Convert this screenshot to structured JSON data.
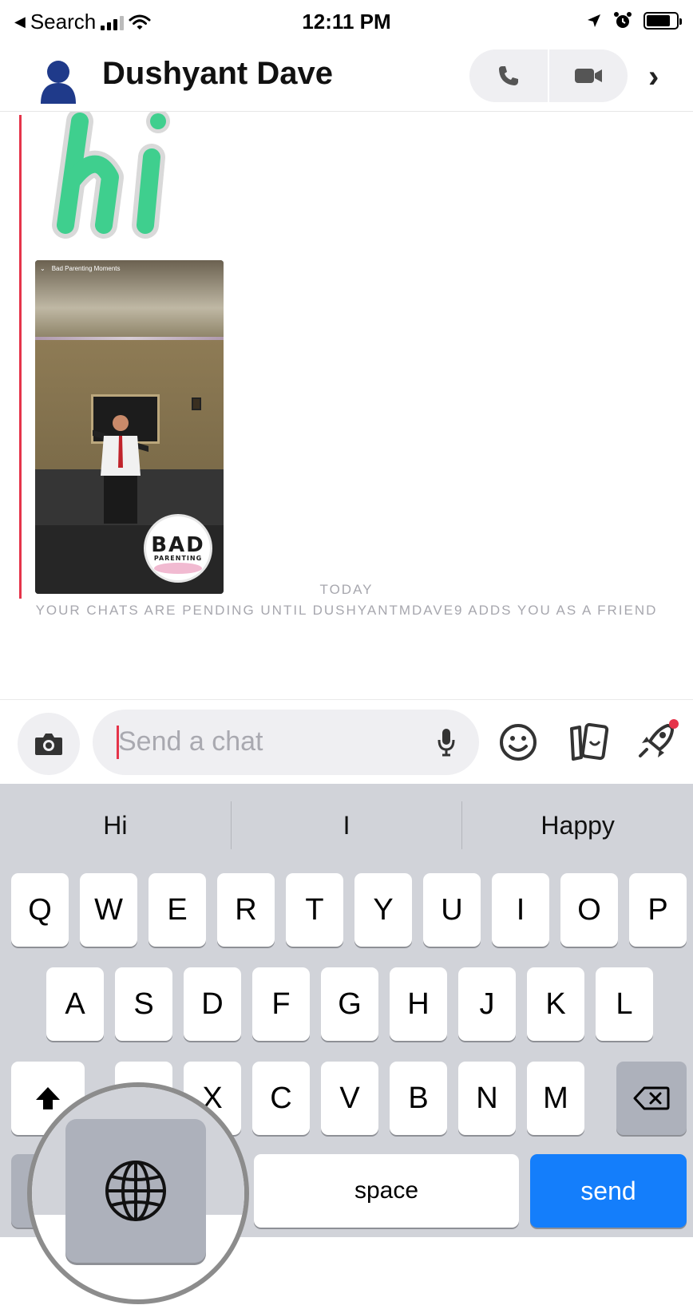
{
  "status_bar": {
    "back_label": "Search",
    "time": "12:11 PM"
  },
  "header": {
    "contact_name": "Dushyant Dave"
  },
  "chat": {
    "hi_sticker_text": "hi",
    "story_badge_line1": "BAD",
    "story_badge_line2": "PARENTING",
    "story_title": "Bad Parenting Moments",
    "date_label": "TODAY",
    "pending_notice": "YOUR CHATS ARE PENDING UNTIL DUSHYANTMDAVE9 ADDS YOU AS A FRIEND"
  },
  "compose": {
    "placeholder": "Send a chat"
  },
  "keyboard": {
    "suggestions": [
      "Hi",
      "I",
      "Happy"
    ],
    "row1": [
      "Q",
      "W",
      "E",
      "R",
      "T",
      "Y",
      "U",
      "I",
      "O",
      "P"
    ],
    "row2": [
      "A",
      "S",
      "D",
      "F",
      "G",
      "H",
      "J",
      "K",
      "L"
    ],
    "row3": [
      "X",
      "C",
      "V",
      "B",
      "N",
      "M"
    ],
    "space_label": "space",
    "send_label": "send"
  },
  "colors": {
    "accent_send": "#147efb",
    "red_line": "#e5344a",
    "keyboard_bg": "#d1d3d9",
    "muted_text": "#a7a7ae"
  }
}
